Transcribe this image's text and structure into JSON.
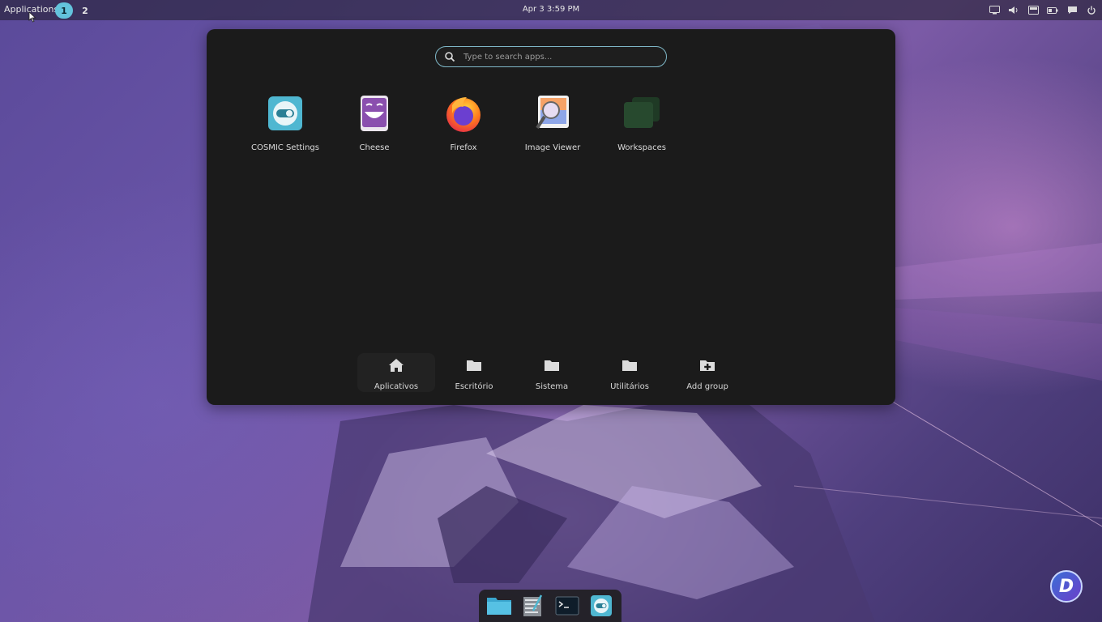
{
  "panel": {
    "applications_label": "Applications",
    "workspaces": [
      "1",
      "2"
    ],
    "clock": "Apr 3 3:59 PM",
    "tray_icons": [
      "display-icon",
      "volume-icon",
      "screen-icon",
      "battery-icon",
      "notifications-icon",
      "power-icon"
    ]
  },
  "launcher": {
    "search_placeholder": "Type to search apps...",
    "apps": [
      {
        "label": "COSMIC Settings",
        "icon": "cosmic-settings-icon"
      },
      {
        "label": "Cheese",
        "icon": "cheese-icon"
      },
      {
        "label": "Firefox",
        "icon": "firefox-icon"
      },
      {
        "label": "Image Viewer",
        "icon": "image-viewer-icon"
      },
      {
        "label": "Workspaces",
        "icon": "workspaces-icon"
      }
    ],
    "groups": [
      {
        "label": "Aplicativos",
        "icon": "home-icon"
      },
      {
        "label": "Escritório",
        "icon": "folder-icon"
      },
      {
        "label": "Sistema",
        "icon": "folder-icon"
      },
      {
        "label": "Utilitários",
        "icon": "folder-icon"
      },
      {
        "label": "Add group",
        "icon": "add-folder-icon"
      }
    ]
  },
  "dock": {
    "items": [
      "files-icon",
      "text-editor-icon",
      "terminal-icon",
      "cosmic-settings-icon"
    ]
  },
  "colors": {
    "accent": "#63c3dc",
    "launcher_bg": "#1b1b1b",
    "search_border": "#7fb8c8"
  }
}
